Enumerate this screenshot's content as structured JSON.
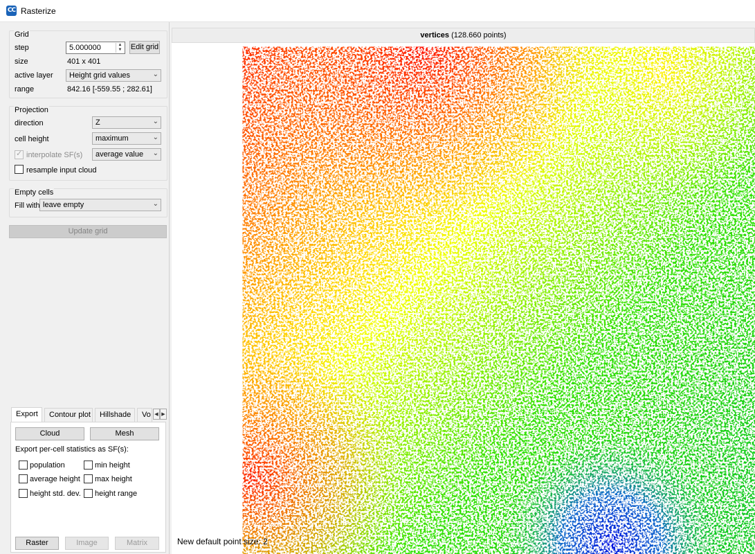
{
  "window": {
    "title": "Rasterize",
    "app_icon": "cloudcompare-icon"
  },
  "grid": {
    "title": "Grid",
    "step_label": "step",
    "step_value": "5.000000",
    "edit_button": "Edit grid",
    "size_label": "size",
    "size_value": "401 x 401",
    "active_layer_label": "active layer",
    "active_layer_value": "Height grid values",
    "range_label": "range",
    "range_value": "842.16 [-559.55 ; 282.61]"
  },
  "projection": {
    "title": "Projection",
    "direction_label": "direction",
    "direction_value": "Z",
    "cell_height_label": "cell height",
    "cell_height_value": "maximum",
    "interpolate_label": "interpolate SF(s)",
    "interpolate_value": "average value",
    "resample_label": "resample input cloud"
  },
  "empty_cells": {
    "title": "Empty cells",
    "fill_label": "Fill with",
    "fill_value": "leave empty"
  },
  "update_button": "Update grid",
  "tabs": [
    "Export",
    "Contour plot",
    "Hillshade",
    "Vo"
  ],
  "export": {
    "cloud_button": "Cloud",
    "mesh_button": "Mesh",
    "stats_label": "Export per-cell statistics as SF(s):",
    "stats": [
      "population",
      "min height",
      "average height",
      "max height",
      "height std. dev.",
      "height range"
    ],
    "raster_button": "Raster",
    "image_button": "Image",
    "matrix_button": "Matrix"
  },
  "view": {
    "title": "vertices",
    "subtitle": "(128.660 points)",
    "status": "New default point size: 2"
  },
  "colors": {
    "accent": "#1a63b8",
    "high": "#ff2000",
    "mid": "#ffff00",
    "low_green": "#20e000",
    "lowest": "#0010e0"
  }
}
